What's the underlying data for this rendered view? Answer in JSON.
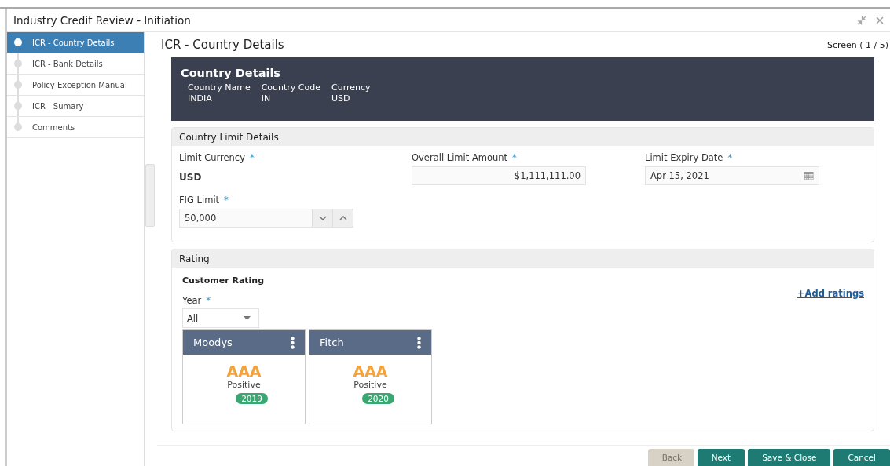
{
  "window": {
    "title": "Industry Credit Review - Initiation"
  },
  "sidebar": {
    "items": [
      {
        "label": "ICR - Country Details",
        "selected": true
      },
      {
        "label": "ICR - Bank Details",
        "selected": false
      },
      {
        "label": "Policy Exception Manual",
        "selected": false
      },
      {
        "label": "ICR - Sumary",
        "selected": false
      },
      {
        "label": "Comments",
        "selected": false
      }
    ]
  },
  "page": {
    "title": "ICR - Country Details",
    "screen_indicator": "Screen ( 1 / 5)"
  },
  "country_details": {
    "title": "Country Details",
    "columns": [
      {
        "label": "Country Name",
        "value": "INDIA"
      },
      {
        "label": "Country Code",
        "value": "IN"
      },
      {
        "label": "Currency",
        "value": "USD"
      }
    ]
  },
  "country_limit_details": {
    "title": "Country Limit Details",
    "fields": [
      {
        "kind": "static",
        "label": "Limit Currency",
        "required_mark": "*",
        "value": "USD"
      },
      {
        "kind": "amount",
        "label": "Overall Limit Amount",
        "required_mark": "*",
        "value": "$1,111,111.00"
      },
      {
        "kind": "date",
        "label": "Limit Expiry Date",
        "required_mark": "*",
        "value": "Apr 15, 2021"
      },
      {
        "kind": "stepper",
        "label": "FIG Limit",
        "required_mark": "*",
        "value": "50,000"
      }
    ]
  },
  "rating": {
    "title": "Rating",
    "subtitle": "Customer Rating",
    "add_link": "+Add ratings",
    "year": {
      "label": "Year",
      "required_mark": "*",
      "value": "All"
    },
    "cards": [
      {
        "agency": "Moodys",
        "grade": "AAA",
        "outlook": "Positive",
        "year": "2019"
      },
      {
        "agency": "Fitch",
        "grade": "AAA",
        "outlook": "Positive",
        "year": "2020"
      }
    ]
  },
  "footer": {
    "buttons": [
      {
        "label": "Back",
        "disabled": true
      },
      {
        "label": "Next",
        "disabled": false
      },
      {
        "label": "Save & Close",
        "disabled": false
      },
      {
        "label": "Cancel",
        "disabled": false
      }
    ]
  }
}
